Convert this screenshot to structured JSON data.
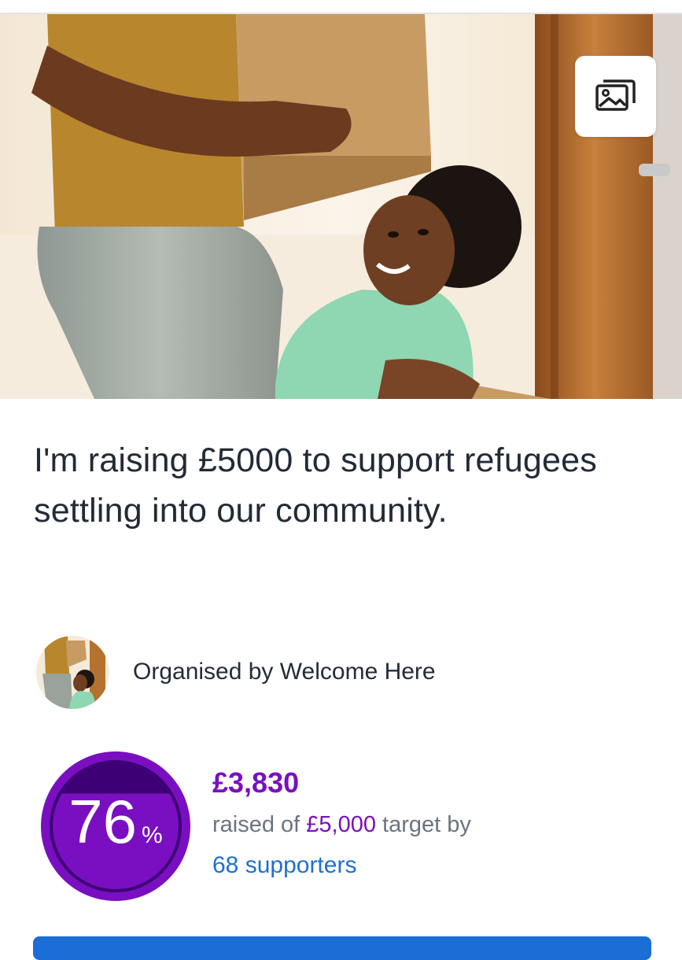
{
  "hero": {
    "gallery_icon": "image-gallery-icon"
  },
  "title": "I'm raising £5000 to support refugees settling into our community.",
  "organiser": {
    "text": "Organised by Welcome Here",
    "avatar_icon": "organiser-avatar"
  },
  "progress": {
    "percent": "76",
    "percent_symbol": "%",
    "fraction": 0.76
  },
  "raised": {
    "amount": "£3,830",
    "prefix": "raised of ",
    "target": "£5,000",
    "suffix": " target by",
    "supporters": "68 supporters"
  },
  "colors": {
    "accent_purple": "#7a0fc1",
    "ring_dark": "#3e0075",
    "link_blue": "#1f6fd1",
    "cta_blue": "#1a6ed6"
  }
}
